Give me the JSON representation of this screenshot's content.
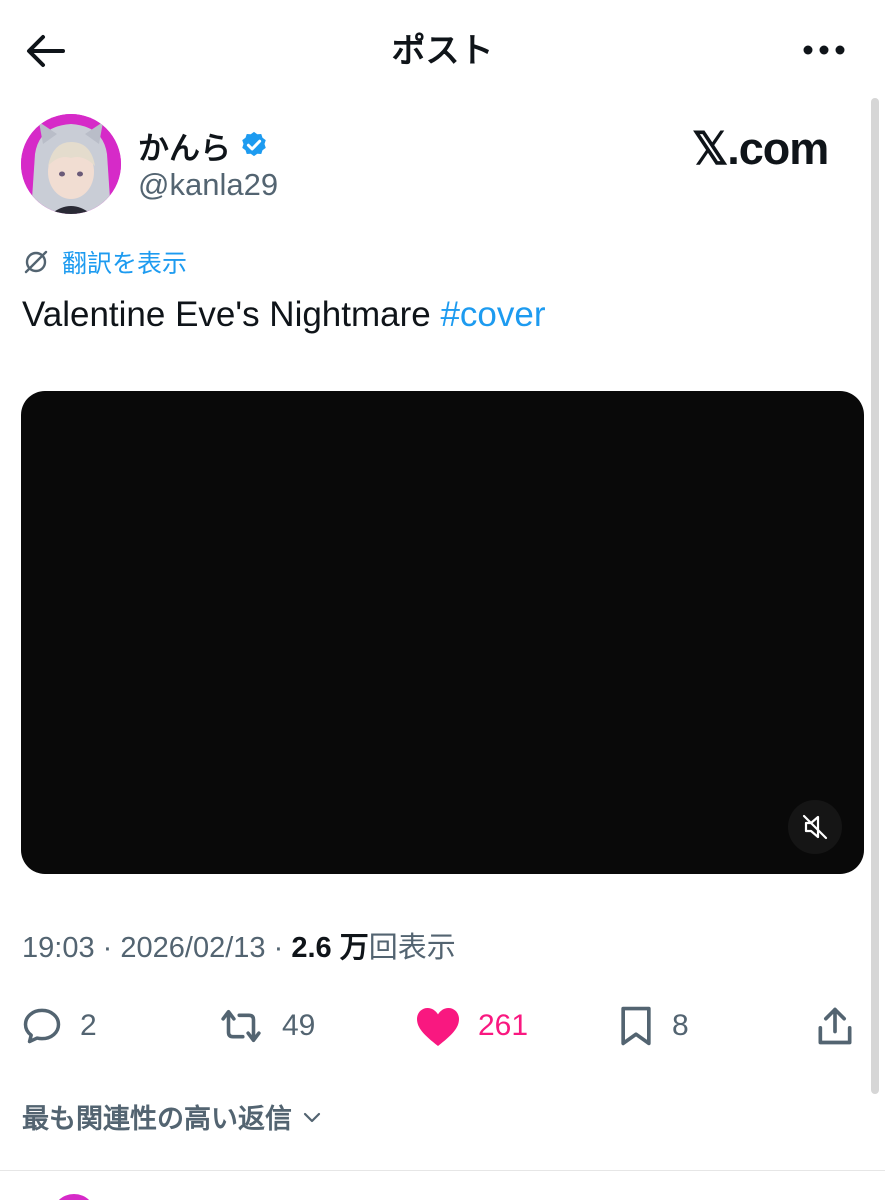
{
  "header": {
    "title": "ポスト"
  },
  "author": {
    "display_name": "かんら",
    "handle": "@kanla29",
    "verified": true
  },
  "watermark": "𝕏.com",
  "translate_label": "翻訳を表示",
  "tweet": {
    "text": "Valentine Eve's Nightmare ",
    "hashtag": "#cover"
  },
  "meta": {
    "time": "19:03",
    "separator": "·",
    "date": "2026/02/13",
    "views_count": "2.6 万",
    "views_label": "回表示"
  },
  "actions": {
    "replies": "2",
    "reposts": "49",
    "likes": "261",
    "bookmarks": "8"
  },
  "replies_sort_label": "最も関連性の高い返信",
  "colors": {
    "accent": "#1d9bf0",
    "like": "#f91880",
    "avatar_bg": "#d62ac8"
  }
}
